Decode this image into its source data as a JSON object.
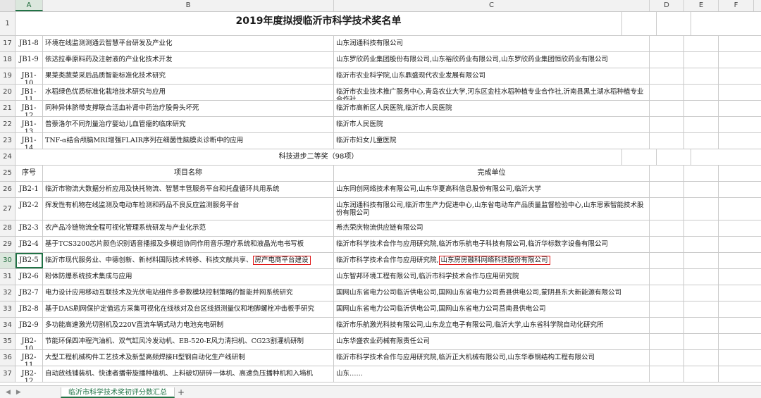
{
  "columns": [
    "A",
    "B",
    "C",
    "D",
    "E",
    "F"
  ],
  "title": "2019年度拟授临沂市科学技术奖名单",
  "rows_top": [
    {
      "n": "17",
      "a": "JB1-8",
      "b": "环境在线监测测通云智慧平台研发及产业化",
      "c": "山东润通科技有限公司"
    },
    {
      "n": "18",
      "a": "JB1-9",
      "b": "依达拉奉原料药及注射液的产业化技术开发",
      "c": "山东罗欣药业集团股份有限公司,山东裕欣药业有限公司,山东罗欣药业集团恒欣药业有限公司"
    },
    {
      "n": "19",
      "a": "JB1-10",
      "b": "果菜类蔬菜采后品质智能标准化技术研究",
      "c": "临沂市农业科学院,山东鼎盛现代农业发展有限公司"
    },
    {
      "n": "20",
      "a": "JB1-11",
      "b": "水稻绿色优质标准化栽培技术研究与应用",
      "c": "临沂市农业技术推广服务中心,青岛农业大学,河东区金柱水稻种植专业合作社,沂南县黑土湖水稻种植专业合作社"
    },
    {
      "n": "21",
      "a": "JB1-12",
      "b": "同种异体脐带支撑联合活血补肾中药治疗股骨头坏死",
      "c": "临沂市高新区人民医院,临沂市人民医院"
    },
    {
      "n": "22",
      "a": "JB1-13",
      "b": "普萘洛尔不同剂量治疗婴幼儿血管瘤的临床研究",
      "c": "临沂市人民医院"
    },
    {
      "n": "23",
      "a": "JB1-14",
      "b": "TNF-α结合颅脑MRI增强FLAIR序列在细菌性脑膜炎诊断中的应用",
      "c": "临沂市妇女儿童医院"
    }
  ],
  "section_title": "科技进步二等奖（98项）",
  "table_header": {
    "n": "25",
    "a": "序号",
    "b": "项目名称",
    "c": "完成单位"
  },
  "rows_bottom": [
    {
      "n": "26",
      "a": "JB2-1",
      "b": "临沂市物流大数据分析应用及快托物流、智慧丰管服务平台和托盘循环共用系统",
      "c": "山东同创网络技术有限公司,山东华夏高科信息股份有限公司,临沂大学"
    },
    {
      "n": "27",
      "a": "JB2-2",
      "b": "挥发性有机物在线监测及电动车检测和药品不良反应监测服务平台",
      "c": "山东润通科技有限公司,临沂市生产力促进中心,山东省电动车产品质量监督检验中心,山东思索智能技术股份有限公司"
    },
    {
      "n": "28",
      "a": "JB2-3",
      "b": "农产品冷链物流全程可视化管理系统研发与产业化示范",
      "c": "希杰荣庆物流供应链有限公司"
    },
    {
      "n": "29",
      "a": "JB2-4",
      "b": "基于TCS3200芯片颜色识别语音播报及多模组协同作用音乐理疗系统和液晶光电书写板",
      "c": "临沂市科学技术合作与应用研究院,临沂市乐航电子科技有限公司,临沂华标数字设备有限公司"
    },
    {
      "n": "30",
      "a": "JB2-5",
      "b_plain": "临沂市现代服务业、中德创新、新材料国际技术转移、科技文献共享、",
      "b_boxed": "房产电商平台建设",
      "c_plain": "临沂市科学技术合作与应用研究院,",
      "c_boxed": "山东房房融科网络科技股份有限公司",
      "active": true
    },
    {
      "n": "31",
      "a": "JB2-6",
      "b": "粉体防爆系统技术集成与应用",
      "c": "山东智邦环境工程有限公司,临沂市科学技术合作与应用研究院"
    },
    {
      "n": "32",
      "a": "JB2-7",
      "b": "电力设计应用移动互联技术及光伏电站组件多参数模块控制策略的智能并网系统研究",
      "c": "国网山东省电力公司临沂供电公司,国网山东省电力公司费县供电公司,蒙阴县东大新能源有限公司"
    },
    {
      "n": "33",
      "a": "JB2-8",
      "b": "基于DAS刷网保护定值远方采集可视化在线核对及台区线损测量仪和地脚螺栓冲击板手研究",
      "c": "国网山东省电力公司临沂供电公司,国网山东省电力公司莒南县供电公司"
    },
    {
      "n": "34",
      "a": "JB2-9",
      "b": "多功能高速激光切割机及220V直流车辆式动力电池充电研制",
      "c": "临沂市乐航激光科技有限公司,山东龙立电子有限公司,临沂大学,山东省科学院自动化研究所"
    },
    {
      "n": "35",
      "a": "JB2-10",
      "b": "节能环保四冲程汽油机、双气缸风冷发动机、EB-520-E风力清扫机、CG23割灌机研制",
      "c": "山东华盛农业药械有限责任公司"
    },
    {
      "n": "36",
      "a": "JB2-11",
      "b": "大型工程机械构件工艺技术及新型高频焊接H型钢自动化生产线研制",
      "c": "临沂市科学技术合作与应用研究院,临沂正大机械有限公司,山东华泰钢结构工程有限公司"
    },
    {
      "n": "37",
      "a": "JB2-12",
      "b": "自动放线铺装机、快速者播带旋播种植机、上料破切研碎一体机、高速负压播种机和入墒机",
      "c": "山东……"
    }
  ],
  "sheet_tab": "临沂市科学技术奖初评分数汇总",
  "icons": {
    "nav_prev": "triangle-left-icon",
    "nav_next": "triangle-right-icon",
    "add_sheet": "plus-icon"
  },
  "colors": {
    "accent": "#217346",
    "highlight_box": "#e01818"
  }
}
